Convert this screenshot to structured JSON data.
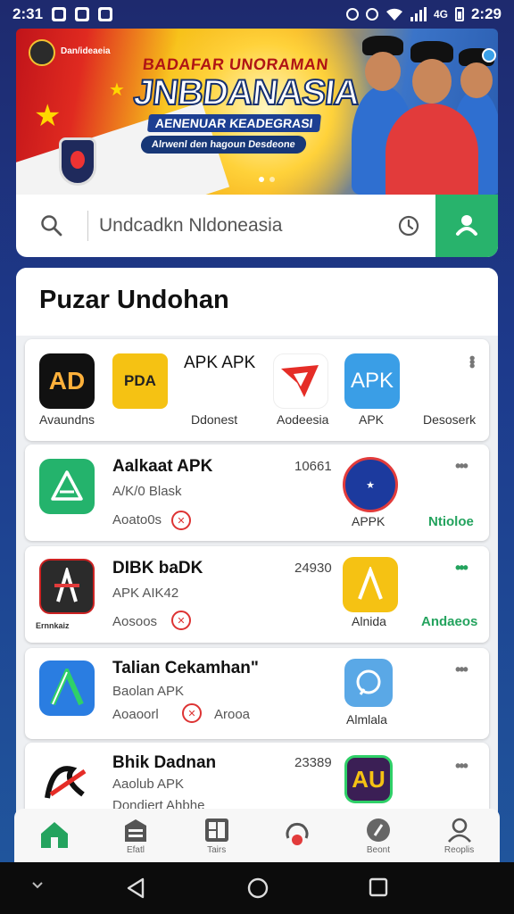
{
  "status_bar": {
    "time": "2:31",
    "right_time": "2:29"
  },
  "banner": {
    "org_name": "Dan/ideaeia",
    "headline_top": "BADAFAR UNORAMAN",
    "headline_main": "JNBDANASIA",
    "headline_sub": "AENENUAR KEADEGRASI",
    "headline_pill": "Alrwenl den hagoun Desdeone"
  },
  "search": {
    "query": "Undcadkn Nldoneasia"
  },
  "section_title": "Puzar Undohan",
  "featured_card": {
    "heading": "APK APK",
    "apps": [
      {
        "icon_text": "AD",
        "label": "Avaundns"
      },
      {
        "icon_text": "PDA",
        "label": "Ddonest"
      },
      {
        "icon_text": "",
        "label": "Aodeesia"
      },
      {
        "icon_text": "APK",
        "label": "APK"
      },
      {
        "icon_text": "",
        "label": "Desoserk"
      }
    ]
  },
  "list_cards": [
    {
      "title": "Aalkaat APK",
      "sub": "A/K/0   Blask",
      "meta": "Aoato0s",
      "count": "10661",
      "right_label": "APPK",
      "right_link": "Ntioloe"
    },
    {
      "title": "DIBK baDK",
      "sub": "APK   AIK42",
      "meta": "Aosoos",
      "count": "24930",
      "left_caption": "Ernnkaiz",
      "right_label": "Alnida",
      "right_link": "Andaeos"
    },
    {
      "title": "Talian Cekamhan\"",
      "sub": "Baolan  APK",
      "meta": "Aoaoorl",
      "meta2": "Arooa",
      "right_label": "Almlala"
    },
    {
      "title": "Bhik Dadnan",
      "sub": "Aaolub  APK",
      "meta": "Dondiert   Ahbhe",
      "count": "23389",
      "right_icon_text": "AU"
    }
  ],
  "bottom_nav": [
    {
      "label": ""
    },
    {
      "label": "Efatl"
    },
    {
      "label": "Tairs"
    },
    {
      "label": ""
    },
    {
      "label": "Beont"
    },
    {
      "label": "Reoplis"
    }
  ],
  "colors": {
    "accent": "#28b36c",
    "primary_dark": "#1e2a6e",
    "danger": "#d33333"
  }
}
